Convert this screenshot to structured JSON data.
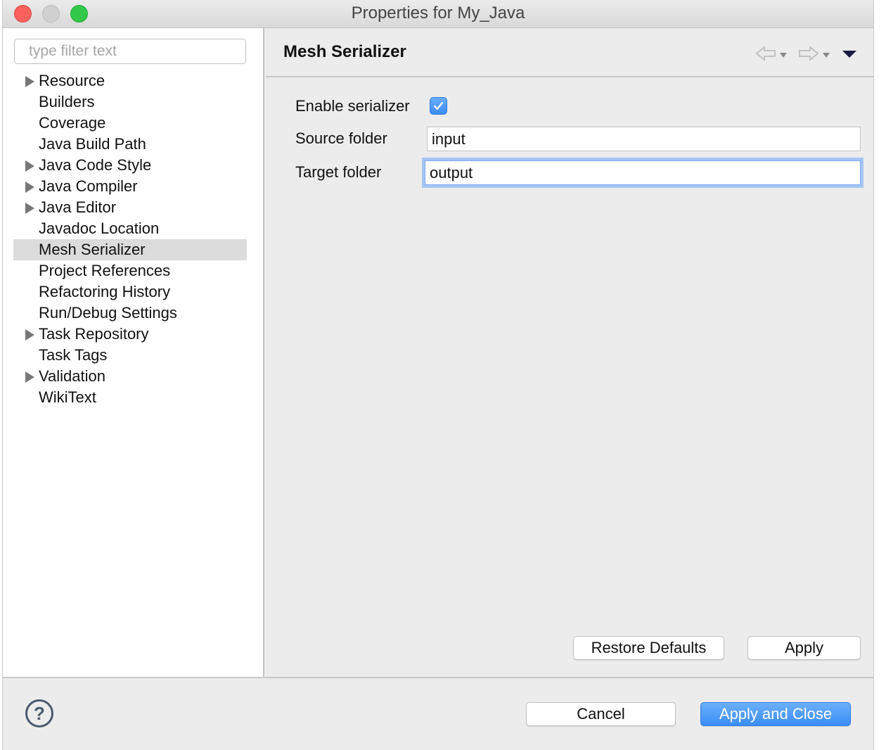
{
  "window": {
    "title": "Properties for My_Java"
  },
  "filter": {
    "placeholder": "type filter text",
    "value": ""
  },
  "tree": {
    "items": [
      {
        "label": "Resource",
        "expandable": true
      },
      {
        "label": "Builders",
        "expandable": false
      },
      {
        "label": "Coverage",
        "expandable": false
      },
      {
        "label": "Java Build Path",
        "expandable": false
      },
      {
        "label": "Java Code Style",
        "expandable": true
      },
      {
        "label": "Java Compiler",
        "expandable": true
      },
      {
        "label": "Java Editor",
        "expandable": true
      },
      {
        "label": "Javadoc Location",
        "expandable": false
      },
      {
        "label": "Mesh Serializer",
        "expandable": false,
        "selected": true
      },
      {
        "label": "Project References",
        "expandable": false
      },
      {
        "label": "Refactoring History",
        "expandable": false
      },
      {
        "label": "Run/Debug Settings",
        "expandable": false
      },
      {
        "label": "Task Repository",
        "expandable": true
      },
      {
        "label": "Task Tags",
        "expandable": false
      },
      {
        "label": "Validation",
        "expandable": true
      },
      {
        "label": "WikiText",
        "expandable": false
      }
    ]
  },
  "page": {
    "title": "Mesh Serializer",
    "nav_icons": [
      "back-arrow-icon",
      "forward-arrow-icon",
      "view-menu-icon"
    ],
    "enable_label": "Enable serializer",
    "enable_checked": true,
    "source_label": "Source folder",
    "source_value": "input",
    "target_label": "Target folder",
    "target_value": "output",
    "restore_defaults_label": "Restore Defaults",
    "apply_label": "Apply"
  },
  "footer": {
    "help_icon": "help-icon",
    "help_glyph": "?",
    "cancel_label": "Cancel",
    "apply_close_label": "Apply and Close"
  },
  "colors": {
    "accent": "#3a8df4",
    "selection": "#dcdcdc",
    "close": "#fc605c",
    "maximize": "#34c84a"
  }
}
